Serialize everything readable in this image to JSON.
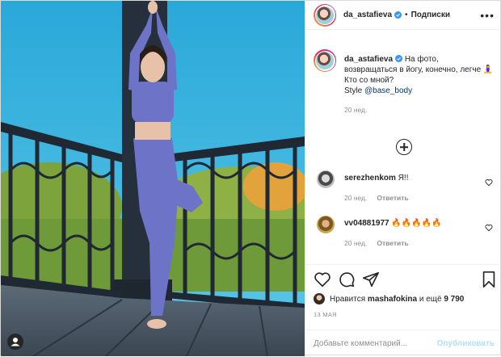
{
  "header": {
    "username": "da_astafieva",
    "separator": "•",
    "follow_label": "Подписки",
    "more_label": "•••",
    "verified_icon": "verified-badge-icon"
  },
  "caption": {
    "username": "da_astafieva",
    "line1": "На фото,",
    "line2": "возвращаться в йогу, конечно, легче",
    "line2_emoji": "🧘‍♀️",
    "line3": "Кто со мной?",
    "line4_prefix": "Style ",
    "mention": "@base_body",
    "time": "20 нед."
  },
  "comments": [
    {
      "username": "serezhenkom",
      "text": "Я!!",
      "time": "20 нед.",
      "reply": "Ответить"
    },
    {
      "username": "vv04881977",
      "text": "🔥🔥🔥🔥🔥",
      "time": "20 нед.",
      "reply": "Ответить"
    }
  ],
  "actions": {
    "icons": [
      "heart-icon",
      "comment-icon",
      "share-icon",
      "bookmark-icon"
    ],
    "likes_prefix": "Нравится ",
    "likes_user": "mashafokina",
    "likes_middle": " и ещё ",
    "likes_count": "9 790",
    "date": "13 МАЯ"
  },
  "composer": {
    "placeholder": "Добавьте комментарий...",
    "publish_label": "Опубликовать"
  },
  "colors": {
    "accent_link": "#00376b",
    "muted": "#8e8e8e",
    "publish_disabled": "#b2dffc",
    "verified": "#3897f0",
    "sky": "#2fb3e0",
    "outfit": "#6d74c8"
  }
}
